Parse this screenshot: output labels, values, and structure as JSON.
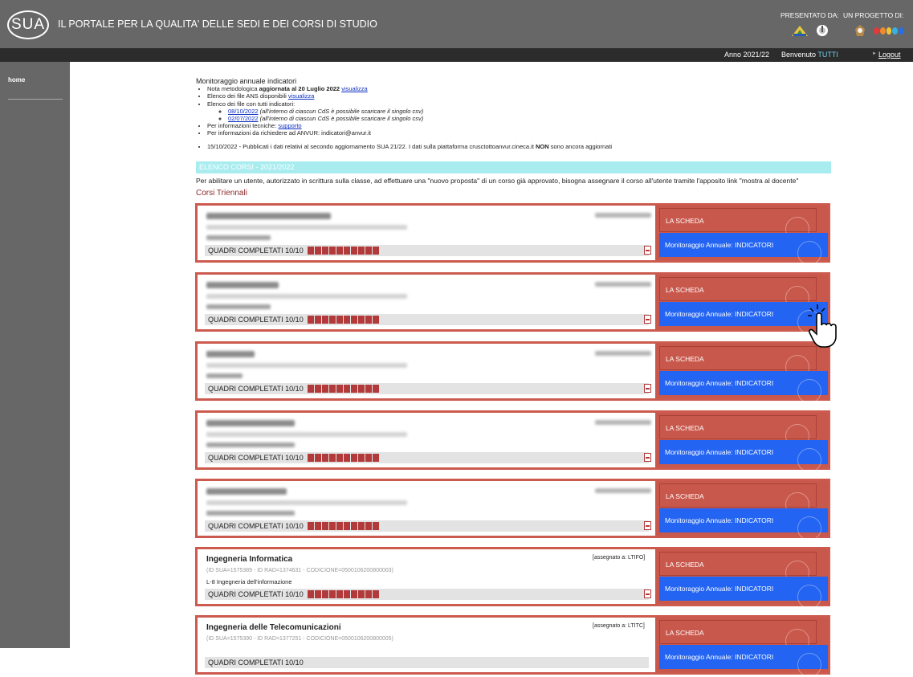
{
  "header": {
    "logo_text": "SUA",
    "title": "IL PORTALE PER LA QUALITA' DELLE SEDI E DEI CORSI DI STUDIO",
    "presented_by": "PRESENTATO DA:",
    "project_by": "UN PROGETTO DI:"
  },
  "subbar": {
    "year": "Anno 2021/22",
    "welcome_prefix": "Benvenuto",
    "user": "TUTTI",
    "logout": "Logout"
  },
  "sidebar": {
    "home": "home"
  },
  "info": {
    "title": "Monitoraggio annuale indicatori",
    "nota_prefix": "Nota metodologica",
    "nota_bold": "aggiornata al 20 Luglio 2022",
    "nota_link": "visualizza",
    "ans_text": "Elenco dei file ANS disponibili",
    "ans_link": "visualizza",
    "all_text": "Elenco dei file con tutti indicatori:",
    "file1_link": "08/10/2022",
    "file1_note": "(all'interno di ciascun CdS è possibile scaricare il singolo csv)",
    "file2_link": "02/07/2022",
    "file2_note": "(all'interno di ciascun CdS è possibile scaricare il singolo csv)",
    "tech_text": "Per informazioni tecniche:",
    "tech_link": "supporto",
    "anvur_text": "Per informazioni da richiedere ad ANVUR: indicatori@anvur.it",
    "news_text": "15/10/2022 - Pubblicati i dati relativi al secondo aggiornamento SUA 21/22. I dati sulla piattaforma crusctottoanvur.cineca.it",
    "news_bold": "NON",
    "news_end": "sono ancora aggiornati"
  },
  "list_header": "ELENCO CORSI - 2021/2022",
  "notice": "Per abilitare un utente, autorizzato in scrittura sulla classe, ad effettuare una \"nuovo proposta\" di un corso già approvato, bisogna assegnare il corso all'utente tramite l'apposito link \"mostra al docente\"",
  "section_title": "Corsi Triennali",
  "courses": [
    {
      "quadri": "QUADRI COMPLETATI 10/10",
      "scheda": "LA SCHEDA",
      "indicatori": "Monitoraggio Annuale: INDICATORI"
    },
    {
      "quadri": "QUADRI COMPLETATI 10/10",
      "scheda": "LA SCHEDA",
      "indicatori": "Monitoraggio Annuale: INDICATORI"
    },
    {
      "quadri": "QUADRI COMPLETATI 10/10",
      "scheda": "LA SCHEDA",
      "indicatori": "Monitoraggio Annuale: INDICATORI"
    },
    {
      "quadri": "QUADRI COMPLETATI 10/10",
      "scheda": "LA SCHEDA",
      "indicatori": "Monitoraggio Annuale: INDICATORI"
    },
    {
      "quadri": "QUADRI COMPLETATI 10/10",
      "scheda": "LA SCHEDA",
      "indicatori": "Monitoraggio Annuale: INDICATORI"
    },
    {
      "name": "Ingegneria Informatica",
      "assigned": "[assegnato a: LTIFO]",
      "ids": "(ID SUA=1575389 - ID RAD=1374631 - CODICIONE=0500106200800003)",
      "class": "L-8 Ingegneria dell'informazione",
      "quadri": "QUADRI COMPLETATI 10/10",
      "scheda": "LA SCHEDA",
      "indicatori": "Monitoraggio Annuale: INDICATORI"
    },
    {
      "name": "Ingegneria delle Telecomunicazioni",
      "assigned": "[assegnato a: LTITC]",
      "ids": "(ID SUA=1575390 - ID RAD=1377251 - CODICIONE=0500106200800005)",
      "quadri": "QUADRI COMPLETATI 10/10",
      "scheda": "LA SCHEDA",
      "indicatori": "Monitoraggio Annuale: INDICATORI"
    }
  ],
  "colors": {
    "header_bg": "#676767",
    "card_border": "#cc5a4e",
    "button_blue": "#2364f2",
    "list_header": "#a9ecef"
  }
}
